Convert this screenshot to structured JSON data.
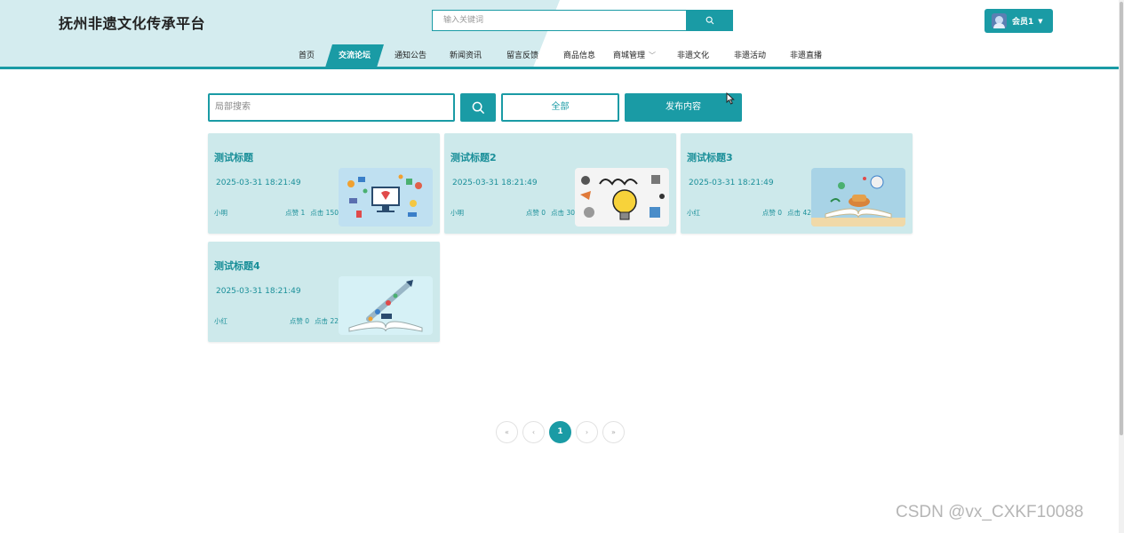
{
  "header": {
    "site_title": "抚州非遗文化传承平台",
    "search_placeholder": "输入关键词",
    "user_label": "会员1",
    "accent_color": "#1a9ba5",
    "header_bg": "#d4ecef"
  },
  "nav": {
    "items": [
      {
        "label": "首页"
      },
      {
        "label": "交流论坛"
      },
      {
        "label": "通知公告"
      },
      {
        "label": "新闻资讯"
      },
      {
        "label": "留言反馈"
      },
      {
        "label": "商品信息"
      },
      {
        "label": "商城管理"
      },
      {
        "label": "非遗文化"
      },
      {
        "label": "非遗活动"
      },
      {
        "label": "非遗直播"
      }
    ],
    "active": "交流论坛"
  },
  "toolbar": {
    "local_search_placeholder": "局部搜索",
    "all_label": "全部",
    "publish_label": "发布内容"
  },
  "posts": [
    {
      "title": "测试标题",
      "date": "2025-03-31 18:21:49",
      "author": "小明",
      "likes": "点赞 1",
      "clicks": "点击 150",
      "image": "tech-illustration"
    },
    {
      "title": "测试标题2",
      "date": "2025-03-31 18:21:49",
      "author": "小明",
      "likes": "点赞 0",
      "clicks": "点击 30",
      "image": "learn-bulb-illustration"
    },
    {
      "title": "测试标题3",
      "date": "2025-03-31 18:21:49",
      "author": "小红",
      "likes": "点赞 0",
      "clicks": "点击 42",
      "image": "open-book-illustration"
    },
    {
      "title": "测试标题4",
      "date": "2025-03-31 18:21:49",
      "author": "小红",
      "likes": "点赞 0",
      "clicks": "点击 22",
      "image": "book-rocket-illustration"
    }
  ],
  "pagination": {
    "first": "«",
    "prev": "‹",
    "current": "1",
    "next": "›",
    "last": "»"
  },
  "watermark": "CSDN @vx_CXKF10088"
}
